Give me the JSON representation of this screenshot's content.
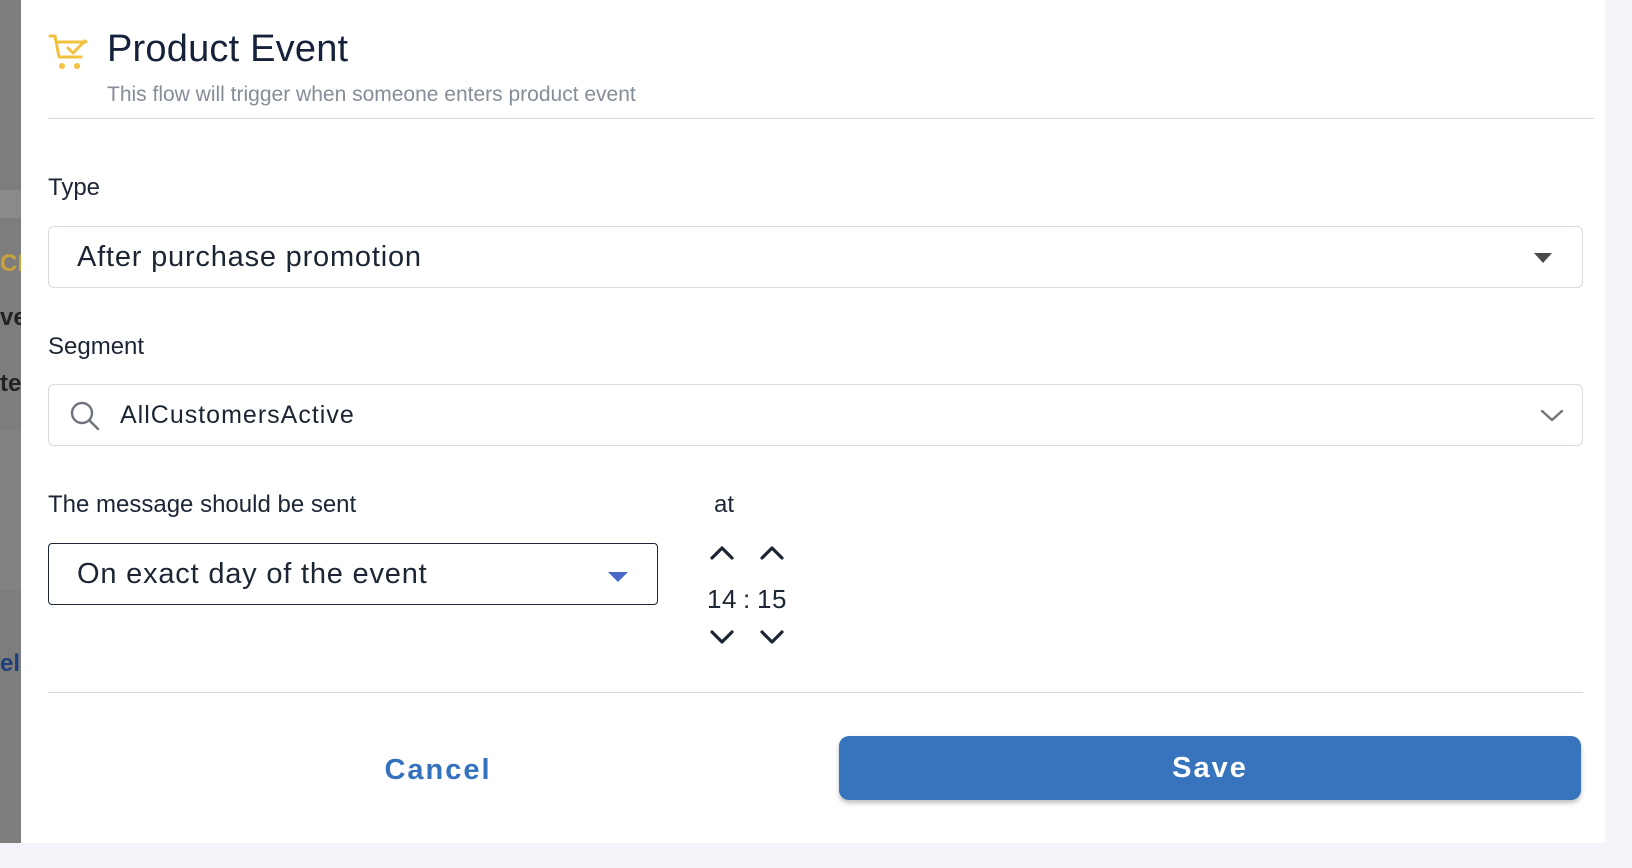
{
  "background": {
    "fragments": [
      "CE",
      "ve",
      "te",
      "el"
    ]
  },
  "dialog": {
    "icon": "cart-check-icon",
    "title": "Product Event",
    "subtitle": "This flow will trigger when someone enters product event"
  },
  "type_field": {
    "label": "Type",
    "value": "After purchase promotion",
    "icon": "caret-down-icon"
  },
  "segment_field": {
    "label": "Segment",
    "value": "AllCustomersActive",
    "search_icon": "search-icon",
    "chevron_icon": "chevron-down-icon"
  },
  "schedule": {
    "label": "The message should be sent",
    "value": "On exact day of the event",
    "at_label": "at",
    "hour": "14",
    "separator": ":",
    "minute": "15"
  },
  "actions": {
    "cancel_label": "Cancel",
    "save_label": "Save"
  },
  "colors": {
    "accent": "#3873bd",
    "icon_yellow": "#f2c13f",
    "caret_blue": "#4a68c8"
  }
}
